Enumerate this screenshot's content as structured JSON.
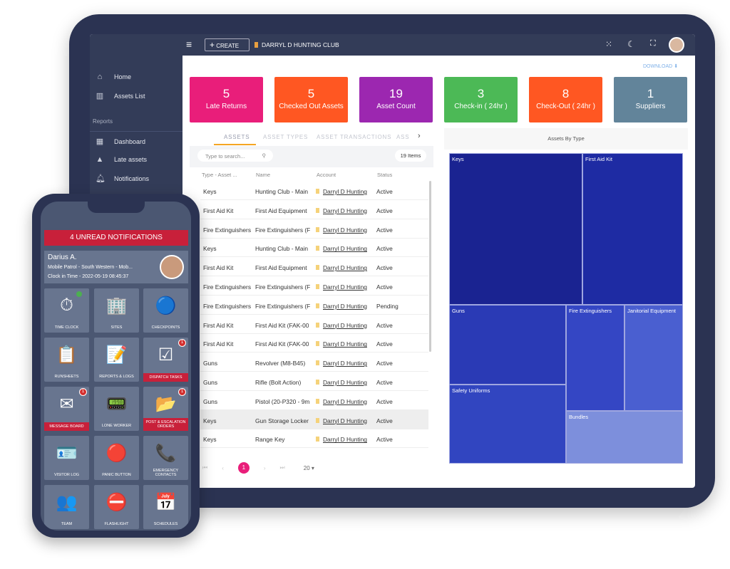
{
  "topbar": {
    "create": "CREATE",
    "club": "DARRYL D HUNTING CLUB"
  },
  "sidebar": {
    "items": [
      {
        "label": "Home",
        "icon": "home-icon"
      },
      {
        "label": "Assets List",
        "icon": "barcode-icon"
      }
    ],
    "section": "Reports",
    "reports": [
      {
        "label": "Dashboard",
        "icon": "dashboard-icon"
      },
      {
        "label": "Late assets",
        "icon": "warning-icon"
      },
      {
        "label": "Notifications",
        "icon": "bell-icon"
      }
    ]
  },
  "download": "DOWNLOAD",
  "cards": [
    {
      "n": "5",
      "l": "Late Returns",
      "c": "#e91e7a"
    },
    {
      "n": "5",
      "l": "Checked Out Assets",
      "c": "#ff5722"
    },
    {
      "n": "19",
      "l": "Asset Count",
      "c": "#9c27b0"
    },
    {
      "n": "3",
      "l": "Check-in ( 24hr )",
      "c": "#4cb956"
    },
    {
      "n": "8",
      "l": "Check-Out ( 24hr )",
      "c": "#ff5722"
    },
    {
      "n": "1",
      "l": "Suppliers",
      "c": "#62849a"
    }
  ],
  "tabs": [
    "ASSETS",
    "ASSET TYPES",
    "ASSET TRANSACTIONS",
    "ASSE"
  ],
  "search_placeholder": "Type to search...",
  "items_count": "19 Items",
  "columns": [
    "Type - Asset ...",
    "Name",
    "Account",
    "Status"
  ],
  "rows": [
    [
      "Keys",
      "Hunting Club - Main",
      "Darryl D Hunting",
      "Active"
    ],
    [
      "First Aid Kit",
      "First Aid Equipment",
      "Darryl D Hunting",
      "Active"
    ],
    [
      "Fire Extinguishers",
      "Fire Extinguishers (F",
      "Darryl D Hunting",
      "Active"
    ],
    [
      "Keys",
      "Hunting Club - Main",
      "Darryl D Hunting",
      "Active"
    ],
    [
      "First Aid Kit",
      "First Aid Equipment",
      "Darryl D Hunting",
      "Active"
    ],
    [
      "Fire Extinguishers",
      "Fire Extinguishers (F",
      "Darryl D Hunting",
      "Active"
    ],
    [
      "Fire Extinguishers",
      "Fire Extinguishers (F",
      "Darryl D Hunting",
      "Pending"
    ],
    [
      "First Aid Kit",
      "First Aid Kit (FAK-00",
      "Darryl D Hunting",
      "Active"
    ],
    [
      "First Aid Kit",
      "First Aid Kit (FAK-00",
      "Darryl D Hunting",
      "Active"
    ],
    [
      "Guns",
      "Revolver (M8-B45)",
      "Darryl D Hunting",
      "Active"
    ],
    [
      "Guns",
      "Rifle (Bolt Action)",
      "Darryl D Hunting",
      "Active"
    ],
    [
      "Guns",
      "Pistol (20-P320 - 9m",
      "Darryl D Hunting",
      "Active"
    ],
    [
      "Keys",
      "Gun Storage Locker",
      "Darryl D Hunting",
      "Active"
    ],
    [
      "Keys",
      "Range Key",
      "Darryl D Hunting",
      "Active"
    ]
  ],
  "pagination": {
    "page": "1",
    "page_size": "20"
  },
  "treemap": {
    "title": "Assets By Type",
    "cells": [
      {
        "label": "Keys",
        "color": "#1a2391"
      },
      {
        "label": "First Aid Kit",
        "color": "#1e2ba3"
      },
      {
        "label": "Guns",
        "color": "#2a3ab5"
      },
      {
        "label": "Fire Extinguishers",
        "color": "#3446c4"
      },
      {
        "label": "Janitorial Equipment",
        "color": "#4a5fd0"
      },
      {
        "label": "Safety Uniforms",
        "color": "#3145c0"
      },
      {
        "label": "Bundles",
        "color": "#7d8fdc"
      }
    ]
  },
  "phone": {
    "notifications": "4 UNREAD NOTIFICATIONS",
    "name": "Darius A.",
    "role": "Mobile Patrol - South Western - Mob...",
    "clock": "Clock in Time - 2022-05-19 08:45:37",
    "tiles": [
      {
        "l": "TIME CLOCK",
        "i": "⏱"
      },
      {
        "l": "SITES",
        "i": "🏢"
      },
      {
        "l": "CHECKPOINTS",
        "i": "🔵"
      },
      {
        "l": "RUNSHEETS",
        "i": "📋"
      },
      {
        "l": "REPORTS & LOGS",
        "i": "📝"
      },
      {
        "l": "DISPATCH TASKS",
        "i": "☑",
        "b": "1",
        "red": true
      },
      {
        "l": "MESSAGE BOARD",
        "i": "✉",
        "b": "1",
        "red": true
      },
      {
        "l": "LONE WORKER",
        "i": "📟"
      },
      {
        "l": "POST & ESCALATION ORDERS",
        "i": "📂",
        "b": "1",
        "red": true
      },
      {
        "l": "VISITOR LOG",
        "i": "🪪"
      },
      {
        "l": "PANIC BUTTON",
        "i": "🔴"
      },
      {
        "l": "EMERGENCY CONTACTS",
        "i": "📞"
      },
      {
        "l": "TEAM",
        "i": "👥"
      },
      {
        "l": "FLASHLIGHT",
        "i": "⛔"
      },
      {
        "l": "SCHEDULES",
        "i": "📅"
      }
    ]
  }
}
